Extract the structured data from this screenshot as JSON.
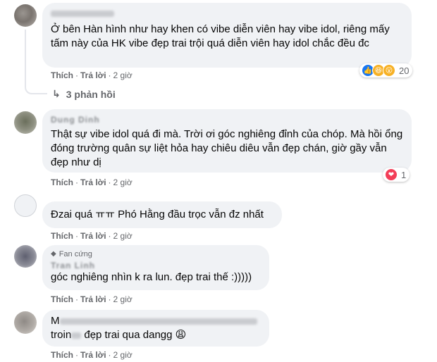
{
  "comments": [
    {
      "name": "",
      "text": "Ở bên Hàn hình như hay khen có vibe diễn viên hay vibe idol, riêng mấy tấm này của HK vibe đẹp trai trội quá diễn viên hay idol chắc đều đc",
      "like_label": "Thích",
      "reply_label": "Trả lời",
      "time": "2 giờ",
      "reactions_count": "20",
      "replies_label": "3 phản hồi"
    },
    {
      "name": "Dung Dinh",
      "text": "Thật sự vibe idol quá đi mà. Trời ơi góc nghiêng đỉnh của chóp. Mà hồi ổng đóng trường quân sự liệt hỏa hay chiêu diêu vẫn đẹp chán, giờ gầy vẫn đẹp như dị",
      "like_label": "Thích",
      "reply_label": "Trả lời",
      "time": "2 giờ",
      "reactions_count": "1"
    },
    {
      "name": "",
      "text": "Đzai quá ㅠㅠ Phó Hằng đầu trọc vẫn đz nhất",
      "like_label": "Thích",
      "reply_label": "Trả lời",
      "time": "2 giờ"
    },
    {
      "badge": "Fan cứng",
      "name": "Tran Linh",
      "text": "góc nghiêng nhìn k ra lun. đẹp trai thế :)))))",
      "like_label": "Thích",
      "reply_label": "Trả lời",
      "time": "2 giờ"
    },
    {
      "name": "",
      "line1_prefix": "M",
      "line2_prefix": "troin",
      "line2_suffix": "đẹp trai qua dangg",
      "emoji": "😩",
      "like_label": "Thích",
      "reply_label": "Trả lời",
      "time": "2 giờ"
    }
  ],
  "colors": {
    "bubble": "#f0f2f5",
    "meta": "#65676b",
    "like_blue": "#1877f2",
    "love_red": "#f33e58",
    "haha_yellow": "#f7b125"
  }
}
